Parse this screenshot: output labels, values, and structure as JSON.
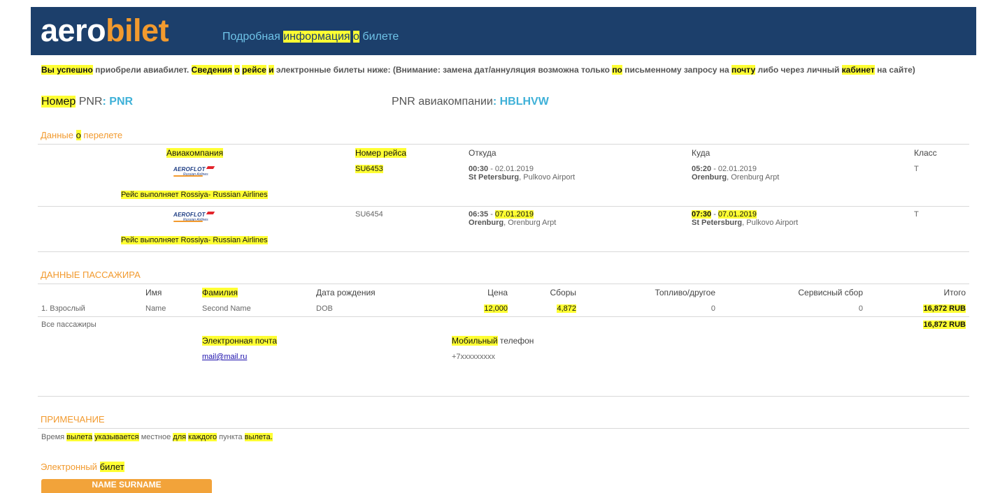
{
  "header": {
    "logo_part1": "aero",
    "logo_part2": "bilet",
    "title_pre": "Подробная ",
    "title_hl1": "информация",
    "title_space": " ",
    "title_hl2": "о",
    "title_post": " билете"
  },
  "intro": {
    "p1": "Вы успешно",
    "p2": " приобрели авиабилет. ",
    "p3": "Сведения",
    "p4": " ",
    "p5": "о",
    "p6": " ",
    "p7": "рейсе",
    "p8": " ",
    "p9": "и",
    "p10": " электронные билеты ниже: (Внимание: замена дат/аннуляция возможна только ",
    "p11": "по",
    "p12": " письменному запросу на ",
    "p13": "почту",
    "p14": " либо через личный ",
    "p15": "кабинет",
    "p16": " на сайте)"
  },
  "pnr": {
    "label_hl": "Номер",
    "label_rest": " PNR",
    "colon": ": ",
    "value": "PNR",
    "airline_label": "PNR авиакомпании",
    "airline_value": "HBLHVW"
  },
  "flight_section": {
    "title_pre": "Данные ",
    "title_hl": "о",
    "title_post": " перелете",
    "headers": {
      "airline": "Авиакомпания",
      "flight_no": "Номер рейса",
      "from": "Откуда",
      "to": "Куда",
      "class": "Класс"
    },
    "segments": [
      {
        "airline_logo": "AEROFLOT",
        "airline_logo_sub": "Russian Airlines",
        "flight_no": "SU6453",
        "dep_time": "00:30",
        "dep_sep": " - ",
        "dep_date": "02.01.2019",
        "dep_city": "St Petersburg",
        "dep_airport": ", Pulkovo Airport",
        "arr_time": "05:20",
        "arr_sep": " - ",
        "arr_date": "02.01.2019",
        "arr_city": "Orenburg",
        "arr_airport": ", Orenburg Arpt",
        "class": "T",
        "operated_by": "Рейс выполняет Rossiya- Russian Airlines"
      },
      {
        "airline_logo": "AEROFLOT",
        "airline_logo_sub": "Russian Airlines",
        "flight_no": "SU6454",
        "dep_time": "06:35",
        "dep_sep": " - ",
        "dep_date": "07.01.2019",
        "dep_city": "Orenburg",
        "dep_airport": ", Orenburg Arpt",
        "arr_time": "07:30",
        "arr_sep": " - ",
        "arr_date": "07.01.2019",
        "arr_city": "St Petersburg",
        "arr_airport": ", Pulkovo Airport",
        "class": "T",
        "operated_by": "Рейс выполняет Rossiya- Russian Airlines"
      }
    ]
  },
  "passenger_section": {
    "title": "ДАННЫЕ ПАССАЖИРА",
    "headers": {
      "first_name": "Имя",
      "last_name": "Фамилия",
      "dob": "Дата рождения",
      "price": "Цена",
      "fees": "Сборы",
      "fuel": "Топливо/другое",
      "service": "Сервисный сбор",
      "total": "Итого"
    },
    "row": {
      "type": "1. Взрослый",
      "first_name": "Name",
      "last_name": "Second Name",
      "dob": "DOB",
      "price": "12,000",
      "fees": "4,872",
      "fuel": "0",
      "service": "0",
      "total": "16,872 RUB"
    },
    "all_label": "Все пассажиры",
    "all_total": "16,872 RUB",
    "email_label": "Электронная почта",
    "email_value": "mail@mail.ru",
    "phone_label_hl": "Мобильный",
    "phone_label_rest": " телефон",
    "phone_value": "+7xxxxxxxxx"
  },
  "note": {
    "title": "ПРИМЕЧАНИЕ",
    "t1": "Время ",
    "t2": "вылета",
    "t3": " ",
    "t4": "указывается",
    "t5": " местное ",
    "t6": "для",
    "t7": " ",
    "t8": "каждого",
    "t9": " пункта ",
    "t10": "вылета."
  },
  "eticket": {
    "title_pre": "Электронный ",
    "title_hl": "билет",
    "name_bar": "NAME SURNAME"
  }
}
